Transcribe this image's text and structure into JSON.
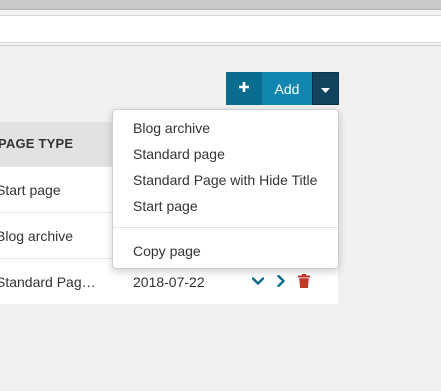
{
  "toolbar": {
    "add_label": "Add"
  },
  "table": {
    "header": {
      "page_type": "PAGE TYPE"
    },
    "rows": [
      {
        "type": "Start page",
        "date": ""
      },
      {
        "type": "Blog archive",
        "date": ""
      },
      {
        "type": "Standard Pag…",
        "date": "2018-07-22"
      }
    ]
  },
  "menu": {
    "items": [
      "Blog archive",
      "Standard page",
      "Standard Page with Hide Title",
      "Start page"
    ],
    "copy": "Copy page"
  },
  "colors": {
    "accent": "#1286b0",
    "accent_dark": "#0a6d8f",
    "caret_bg": "#12455d",
    "delete": "#c0392b",
    "action": "#0a6d8f"
  }
}
